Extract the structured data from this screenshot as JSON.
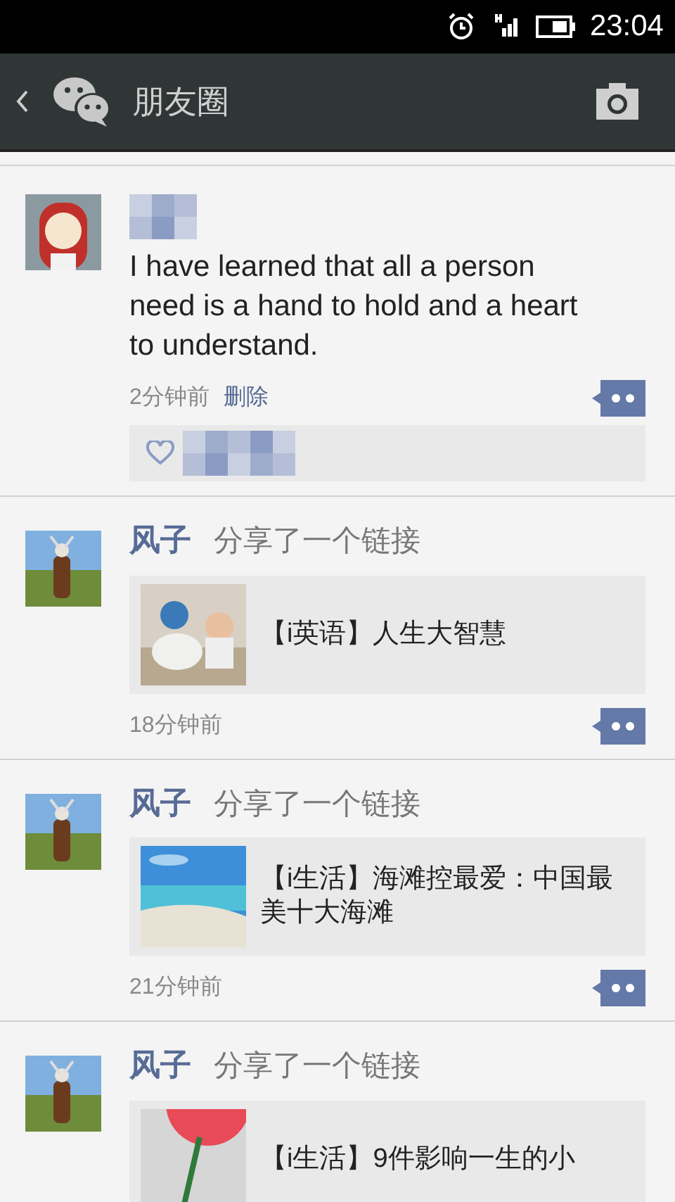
{
  "status_bar": {
    "time": "23:04"
  },
  "header": {
    "title": "朋友圈"
  },
  "posts": [
    {
      "kind": "text",
      "text": "I have learned that all a person need is a hand to hold and a heart to understand.",
      "time": "2分钟前",
      "delete_label": "删除"
    },
    {
      "kind": "link",
      "author": "风子",
      "action": "分享了一个链接",
      "link_title": "【i英语】人生大智慧",
      "time": "18分钟前"
    },
    {
      "kind": "link",
      "author": "风子",
      "action": "分享了一个链接",
      "link_title": "【i生活】海滩控最爱：中国最美十大海滩",
      "time": "21分钟前"
    },
    {
      "kind": "link",
      "author": "风子",
      "action": "分享了一个链接",
      "link_title": "【i生活】9件影响一生的小"
    }
  ]
}
